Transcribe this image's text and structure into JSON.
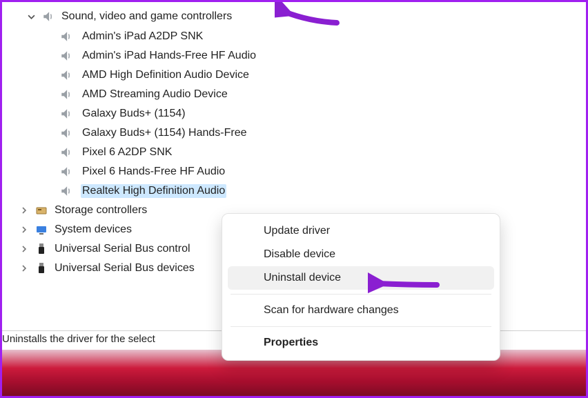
{
  "tree": {
    "sound_category": {
      "label": "Sound, video and game controllers",
      "expanded": true,
      "devices": [
        "Admin's iPad A2DP SNK",
        "Admin's iPad Hands-Free HF Audio",
        "AMD High Definition Audio Device",
        "AMD Streaming Audio Device",
        "Galaxy Buds+ (1154)",
        "Galaxy Buds+ (1154) Hands-Free",
        "Pixel 6 A2DP SNK",
        "Pixel 6 Hands-Free HF Audio",
        "Realtek High Definition Audio"
      ],
      "selected_index": 8
    },
    "other_categories": [
      {
        "label": "Storage controllers",
        "icon": "storage"
      },
      {
        "label": "System devices",
        "icon": "system"
      },
      {
        "label": "Universal Serial Bus controllers",
        "icon": "usb"
      },
      {
        "label": "Universal Serial Bus devices",
        "icon": "usb"
      }
    ]
  },
  "statusbar": {
    "text": "Uninstalls the driver for the selected device."
  },
  "context_menu": {
    "items": [
      {
        "label": "Update driver",
        "hover": false
      },
      {
        "label": "Disable device",
        "hover": false
      },
      {
        "label": "Uninstall device",
        "hover": true
      }
    ],
    "after_sep_items": [
      {
        "label": "Scan for hardware changes",
        "hover": false
      }
    ],
    "default_item": {
      "label": "Properties"
    }
  }
}
